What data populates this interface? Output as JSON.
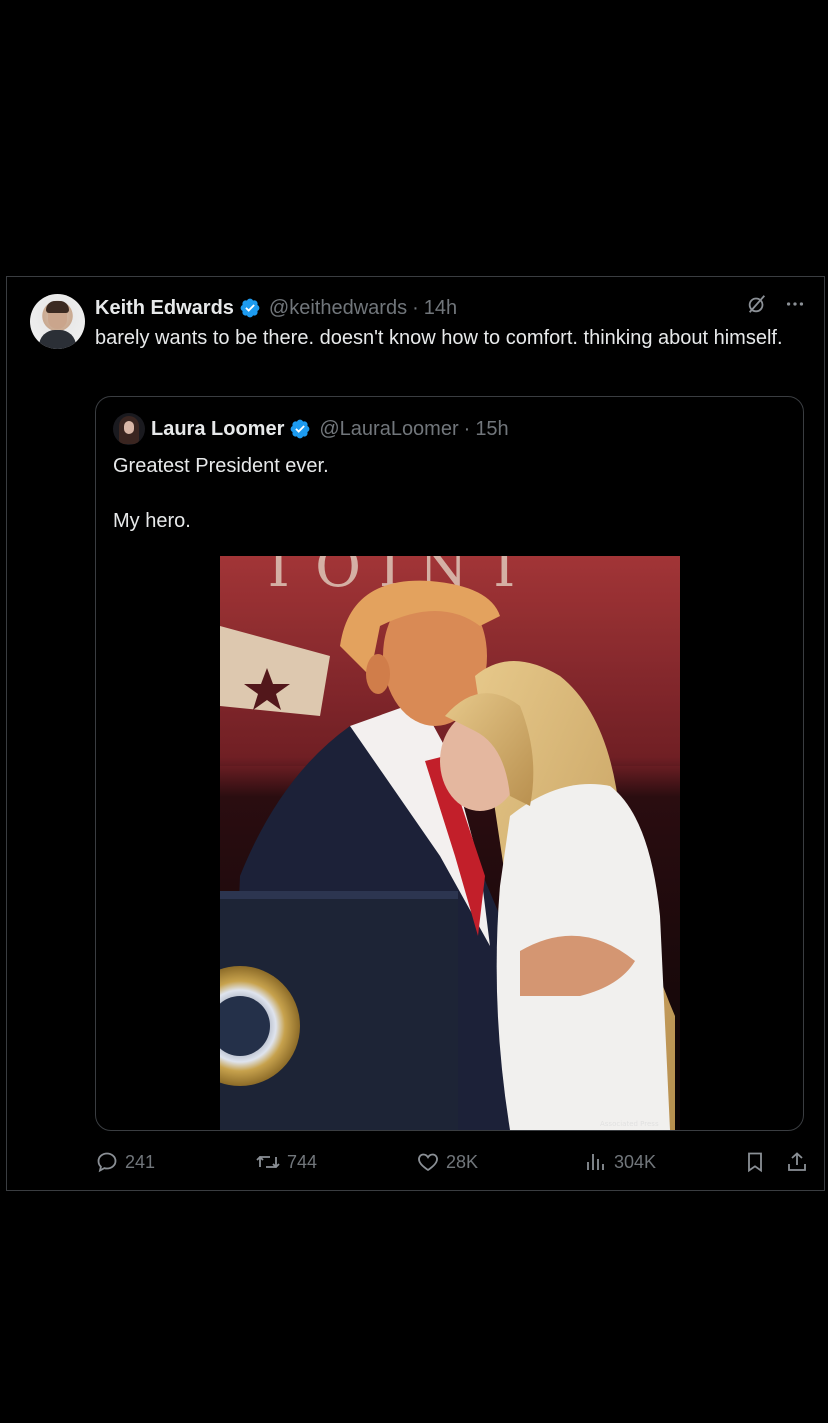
{
  "tweet": {
    "author_name": "Keith Edwards",
    "handle": "@keithedwards",
    "separator": "·",
    "time": "14h",
    "text": "barely wants to be there. doesn't know how to comfort. thinking about himself.",
    "top_icons": [
      "grok-icon",
      "more-icon"
    ]
  },
  "quote": {
    "author_name": "Laura Loomer",
    "handle": "@LauraLoomer",
    "separator": "·",
    "time": "15h",
    "lines": [
      "Greatest President ever.",
      "My hero."
    ],
    "photo_caption_small": "Associated Press"
  },
  "actions": {
    "replies": "241",
    "reposts": "744",
    "likes": "28K",
    "views": "304K"
  },
  "colors": {
    "background": "#000000",
    "text": "#e7e9ea",
    "muted": "#71767b",
    "border": "#3a3d41",
    "verified": "#1d9bf0"
  }
}
